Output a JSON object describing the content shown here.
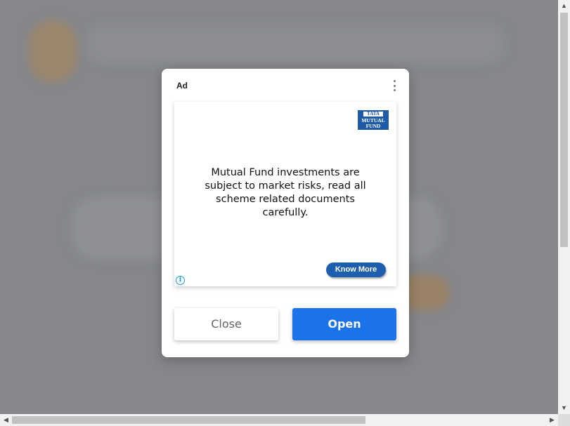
{
  "dialog": {
    "ad_label": "Ad",
    "creative": {
      "brand_top": "TATA",
      "brand_mid": "MUTUAL",
      "brand_bottom": "FUND",
      "disclaimer": "Mutual Fund investments are subject to market risks, read all scheme related documents carefully.",
      "cta_label": "Know More",
      "info_glyph": "i"
    },
    "close_label": "Close",
    "open_label": "Open"
  },
  "colors": {
    "open_button": "#1a73e8",
    "brand_blue": "#1e5aa8",
    "cta_blue": "#1d5fae"
  },
  "icons": [
    "more-vert-icon",
    "info-icon",
    "scroll-up-arrow-icon",
    "scroll-down-arrow-icon",
    "scroll-left-arrow-icon",
    "scroll-right-arrow-icon"
  ]
}
